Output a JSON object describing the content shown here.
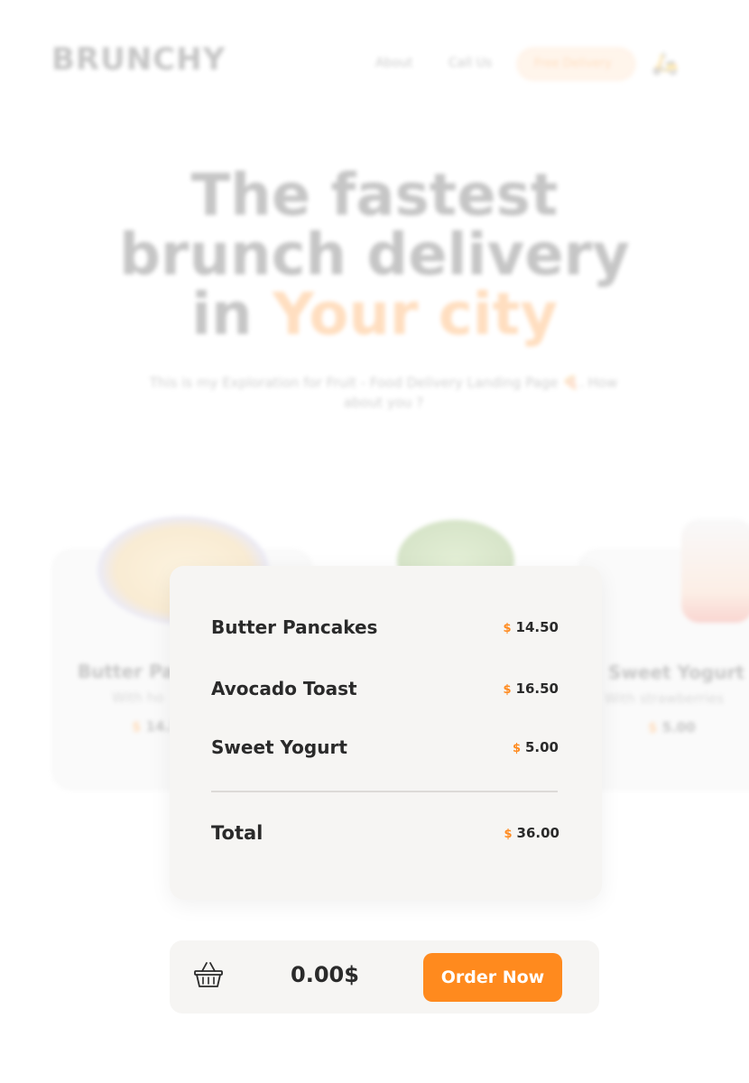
{
  "header": {
    "brand": "BRUNCHY",
    "nav": {
      "about": "About",
      "call": "Call Us",
      "free_delivery": "Free Delivery"
    },
    "scooter_icon": "scooter-icon"
  },
  "hero": {
    "title_line1": "The fastest",
    "title_line2": "brunch delivery",
    "title_prefix": "in",
    "title_accent": "Your city",
    "subtitle": "This is my Exploration for Fruit - Food Delivery Landing Page 🍕. How about you ?"
  },
  "cards": [
    {
      "name": "Butter Pan",
      "desc": "With ho",
      "currency": "$",
      "price": "14.5"
    },
    {
      "name": "Sweet Yogurt",
      "desc": "With strawberries",
      "currency": "$",
      "price": "5.00"
    }
  ],
  "order": {
    "items": [
      {
        "name": "Butter Pancakes",
        "currency": "$",
        "price": "14.50"
      },
      {
        "name": "Avocado Toast",
        "currency": "$",
        "price": "16.50"
      },
      {
        "name": "Sweet Yogurt",
        "currency": "$",
        "price": "5.00"
      }
    ],
    "total_label": "Total",
    "total_currency": "$",
    "total_value": "36.00"
  },
  "cart_bar": {
    "basket_icon": "basket-icon",
    "amount": "0.00$",
    "order_button": "Order Now"
  },
  "colors": {
    "accent": "#ff8a1e",
    "panel": "#f6f5f3",
    "text": "#2a2a2a"
  }
}
